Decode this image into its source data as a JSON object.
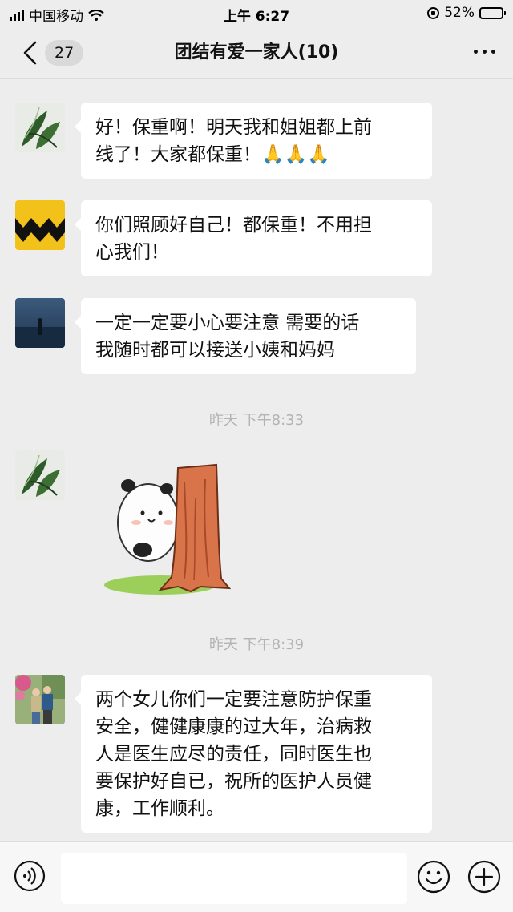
{
  "status_bar": {
    "carrier": "中国移动",
    "time": "上午 6:27",
    "battery_text": "52%",
    "battery_level": 0.52
  },
  "header": {
    "unread_count": "27",
    "title": "团结有爱一家人(10)"
  },
  "messages": [
    {
      "avatar": "plant-avatar",
      "lines": [
        "好！保重啊！明天我和姐姐都上前",
        "线了！大家都保重！🙏🙏🙏"
      ]
    },
    {
      "avatar": "zigzag-avatar",
      "lines": [
        "你们照顾好自己！都保重！不用担",
        "心我们！"
      ]
    },
    {
      "avatar": "sea-avatar",
      "lines": [
        "一定一定要小心要注意 需要的话",
        "我随时都可以接送小姨和妈妈"
      ]
    },
    {
      "timestamp": "昨天 下午8:33"
    },
    {
      "avatar": "plant-avatar",
      "sticker": "panda-behind-tree-sticker"
    },
    {
      "timestamp": "昨天 下午8:39"
    },
    {
      "avatar": "couple-avatar",
      "lines": [
        "两个女儿你们一定要注意防护保重",
        "安全，健健康康的过大年，治病救",
        "人是医生应尽的责任，同时医生也",
        "要保护好自已，祝所的医护人员健",
        "康，工作顺利。"
      ]
    }
  ],
  "input_bar": {
    "placeholder": "",
    "icons": [
      "voice-icon",
      "emoji-icon",
      "plus-icon"
    ]
  },
  "colors": {
    "background": "#ededed",
    "bubble": "#ffffff",
    "timestamp": "#b3b3b3"
  }
}
